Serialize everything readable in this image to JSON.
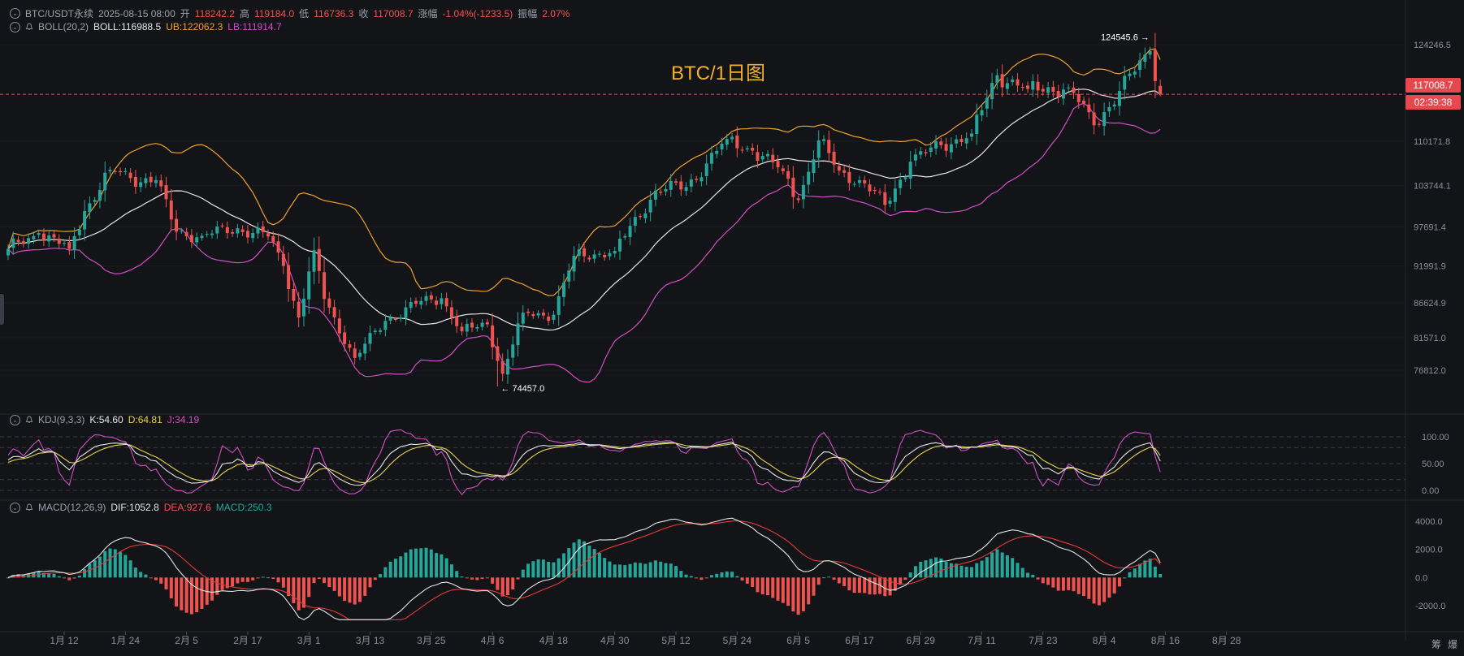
{
  "header": {
    "symbol": "BTC/USDT永续",
    "datetime": "2025-08-15 08:00",
    "open_label": "开",
    "open_value": "118242.2",
    "high_label": "高",
    "high_value": "119184.0",
    "low_label": "低",
    "low_value": "116736.3",
    "close_label": "收",
    "close_value": "117008.7",
    "change_label": "涨幅",
    "change_value": "-1.04%(-1233.5)",
    "amplitude_label": "振幅",
    "amplitude_value": "2.07%"
  },
  "boll_header": {
    "name": "BOLL(20,2)",
    "mid": "BOLL:116988.5",
    "ub": "UB:122062.3",
    "lb": "LB:111914.7"
  },
  "kdj_header": {
    "name": "KDJ(9,3,3)",
    "k": "K:54.60",
    "d": "D:64.81",
    "j": "J:34.19"
  },
  "macd_header": {
    "name": "MACD(12,26,9)",
    "dif": "DIF:1052.8",
    "dea": "DEA:927.6",
    "macd": "MACD:250.3"
  },
  "chart_title": "BTC/1日图",
  "current_price_tag": "117008.7",
  "countdown_tag": "02:39:38",
  "high_annotation": "124545.6",
  "low_annotation": "74457.0",
  "corner_icons": {
    "a": "筹",
    "b": "爆"
  },
  "colors": {
    "up": "#26a69a",
    "down": "#ef5350",
    "boll_mid": "#e6e6e6",
    "boll_ub": "#f0a030",
    "boll_lb": "#d04fc4",
    "kdj_k": "#e6e6e6",
    "kdj_d": "#e8d44d",
    "kdj_j": "#d04fc4",
    "dif": "#e6e6e6",
    "dea": "#e53935",
    "background": "#131417"
  },
  "chart_data": [
    {
      "type": "candlestick",
      "panel": "price",
      "y_ticks": [
        124246.5,
        117008.7,
        110171.8,
        103744.1,
        97691.4,
        91991.9,
        86624.9,
        81571.0,
        76812.0
      ],
      "x_ticks": [
        "1月 12",
        "1月 24",
        "2月 5",
        "2月 17",
        "3月 1",
        "3月 13",
        "3月 25",
        "4月 6",
        "4月 18",
        "4月 30",
        "5月 12",
        "5月 24",
        "6月 5",
        "6月 17",
        "6月 29",
        "7月 11",
        "7月 23",
        "8月 4",
        "8月 16",
        "8月 28"
      ],
      "close_anchors": [
        {
          "date": "2025-01-01",
          "close": 94500
        },
        {
          "date": "2025-01-07",
          "close": 96800
        },
        {
          "date": "2025-01-13",
          "close": 94500
        },
        {
          "date": "2025-01-16",
          "close": 100000
        },
        {
          "date": "2025-01-21",
          "close": 106000
        },
        {
          "date": "2025-01-25",
          "close": 104800
        },
        {
          "date": "2025-01-30",
          "close": 104500
        },
        {
          "date": "2025-02-03",
          "close": 97000
        },
        {
          "date": "2025-02-08",
          "close": 96400
        },
        {
          "date": "2025-02-15",
          "close": 97500
        },
        {
          "date": "2025-02-21",
          "close": 96300
        },
        {
          "date": "2025-02-24",
          "close": 92000
        },
        {
          "date": "2025-02-27",
          "close": 84500
        },
        {
          "date": "2025-03-02",
          "close": 94300
        },
        {
          "date": "2025-03-04",
          "close": 87200
        },
        {
          "date": "2025-03-10",
          "close": 78600
        },
        {
          "date": "2025-03-16",
          "close": 84000
        },
        {
          "date": "2025-03-22",
          "close": 86500
        },
        {
          "date": "2025-03-27",
          "close": 87300
        },
        {
          "date": "2025-03-31",
          "close": 82500
        },
        {
          "date": "2025-04-05",
          "close": 83500
        },
        {
          "date": "2025-04-08",
          "close": 76300
        },
        {
          "date": "2025-04-12",
          "close": 85200
        },
        {
          "date": "2025-04-18",
          "close": 84900
        },
        {
          "date": "2025-04-22",
          "close": 93500
        },
        {
          "date": "2025-04-30",
          "close": 94200
        },
        {
          "date": "2025-05-08",
          "close": 103000
        },
        {
          "date": "2025-05-14",
          "close": 103500
        },
        {
          "date": "2025-05-22",
          "close": 110500
        },
        {
          "date": "2025-05-27",
          "close": 108800
        },
        {
          "date": "2025-06-02",
          "close": 105800
        },
        {
          "date": "2025-06-05",
          "close": 101600
        },
        {
          "date": "2025-06-09",
          "close": 110300
        },
        {
          "date": "2025-06-13",
          "close": 105900
        },
        {
          "date": "2025-06-17",
          "close": 104500
        },
        {
          "date": "2025-06-22",
          "close": 100900
        },
        {
          "date": "2025-06-27",
          "close": 107200
        },
        {
          "date": "2025-07-03",
          "close": 109600
        },
        {
          "date": "2025-07-09",
          "close": 111300
        },
        {
          "date": "2025-07-14",
          "close": 119800
        },
        {
          "date": "2025-07-20",
          "close": 117800
        },
        {
          "date": "2025-07-28",
          "close": 118000
        },
        {
          "date": "2025-08-02",
          "close": 112500
        },
        {
          "date": "2025-08-07",
          "close": 117500
        },
        {
          "date": "2025-08-13",
          "close": 123300
        },
        {
          "date": "2025-08-15",
          "close": 117008.7
        }
      ],
      "series": [
        {
          "name": "BOLL",
          "value": 116988.5
        },
        {
          "name": "UB",
          "value": 122062.3
        },
        {
          "name": "LB",
          "value": 111914.7
        }
      ],
      "annotations": [
        {
          "label": "124545.6",
          "date": "2025-08-14",
          "value": 124545.6
        },
        {
          "label": "74457.0",
          "date": "2025-04-07",
          "value": 74457.0
        }
      ],
      "last_candle": {
        "open": 118242.2,
        "high": 119184.0,
        "low": 116736.3,
        "close": 117008.7
      }
    },
    {
      "type": "line",
      "panel": "kdj",
      "y_ticks": [
        100.0,
        50.0,
        0.0
      ],
      "series": [
        {
          "name": "K",
          "last": 54.6
        },
        {
          "name": "D",
          "last": 64.81
        },
        {
          "name": "J",
          "last": 34.19
        }
      ]
    },
    {
      "type": "bar",
      "panel": "macd",
      "y_ticks": [
        4000.0,
        2000.0,
        0.0,
        -2000.0
      ],
      "series": [
        {
          "name": "DIF",
          "last": 1052.8
        },
        {
          "name": "DEA",
          "last": 927.6
        },
        {
          "name": "MACD",
          "last": 250.3
        }
      ]
    }
  ]
}
